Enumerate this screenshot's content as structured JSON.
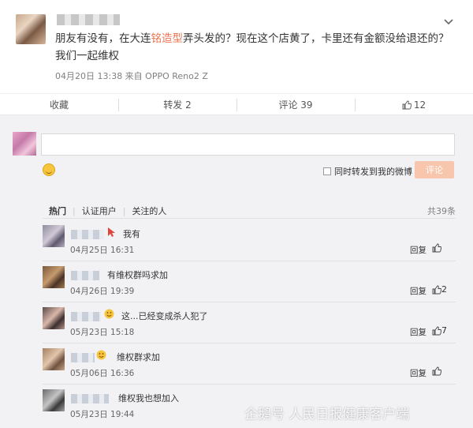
{
  "post": {
    "text_before": "朋友有没有，在大连",
    "text_highlight": "铭造型",
    "text_after": "弄头发的？现在这个店黄了，卡里还有金额没给退还的？我们一起维权",
    "meta": "04月20日 13:38  来自 OPPO Reno2 Z"
  },
  "actions": {
    "favorite": "收藏",
    "repost": "转发 2",
    "comment": "评论 39",
    "like_count": "12"
  },
  "composer": {
    "input_value": "",
    "forward_label": "同时转发到我的微博",
    "submit_label": "评论"
  },
  "filters": {
    "hot": "热门",
    "verified": "认证用户",
    "following": "关注的人",
    "total": "共39条"
  },
  "comments": [
    {
      "text": "我有",
      "time": "04月25日 16:31",
      "reply": "回复",
      "likes": ""
    },
    {
      "text": "有维权群吗求加",
      "time": "04月26日 19:39",
      "reply": "回复",
      "likes": "2"
    },
    {
      "text": "这...已经变成杀人犯了",
      "time": "05月23日 15:18",
      "reply": "回复",
      "likes": "7"
    },
    {
      "text": "维权群求加",
      "time": "05月06日 16:36",
      "reply": "回复",
      "likes": ""
    },
    {
      "text": "维权我也想加入",
      "time": "05月23日 19:44",
      "reply": "回复",
      "likes": ""
    }
  ],
  "watermark": "企鹅号 人民日报健康客户端",
  "colors": {
    "accent": "#eb7350",
    "submit_disabled": "#f8c6ad",
    "background": "#f2f2f5"
  }
}
